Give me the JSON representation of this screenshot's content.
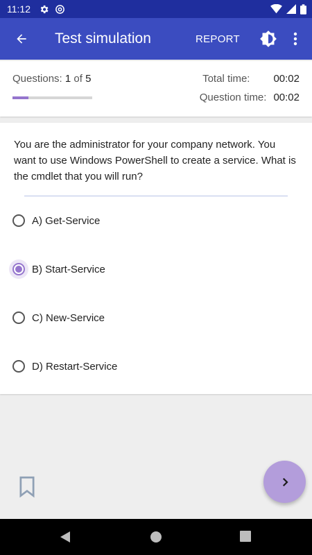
{
  "status_bar": {
    "time": "11:12",
    "icons": [
      "settings-gear-icon",
      "at-sign-icon",
      "wifi-icon",
      "signal-icon",
      "battery-icon"
    ]
  },
  "app_bar": {
    "title": "Test simulation",
    "report_label": "REPORT",
    "icons": {
      "back": "arrow-back-icon",
      "theme": "brightness-icon",
      "more": "more-vert-icon"
    }
  },
  "info": {
    "questions_label": "Questions:",
    "current_question": "1",
    "of_label": "of",
    "total_questions": "5",
    "progress_fraction": 0.2,
    "total_time_label": "Total time:",
    "total_time": "00:02",
    "question_time_label": "Question time:",
    "question_time": "00:02"
  },
  "question": {
    "text": "You are the administrator for your company network. You want to use Windows PowerShell to create a service. What is the cmdlet that you will run?",
    "options": [
      {
        "label": "A) Get-Service",
        "selected": false
      },
      {
        "label": "B) Start-Service",
        "selected": true
      },
      {
        "label": "C) New-Service",
        "selected": false
      },
      {
        "label": "D) Restart-Service",
        "selected": false
      }
    ]
  },
  "controls": {
    "bookmark_icon": "bookmark-outline-icon",
    "next_icon": "chevron-right-icon"
  },
  "colors": {
    "status_bar": "#1f2e9e",
    "app_bar": "#3b4cc0",
    "accent": "#9575cd",
    "fab": "#b39ddb"
  }
}
